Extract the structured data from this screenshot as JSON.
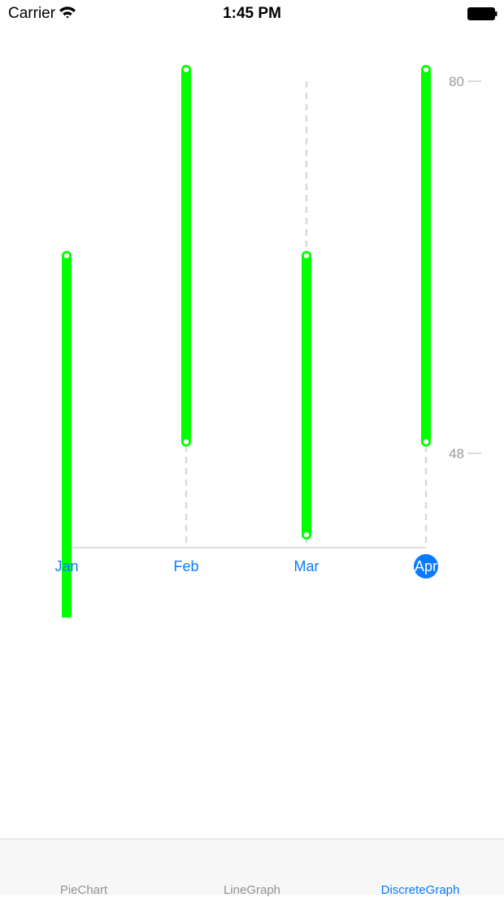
{
  "status_bar": {
    "carrier": "Carrier",
    "time": "1:45 PM",
    "icons": [
      "wifi-icon",
      "battery-icon"
    ]
  },
  "chart_data": {
    "type": "bar",
    "subtype": "floating-range",
    "categories": [
      "Jan",
      "Feb",
      "Mar",
      "Apr"
    ],
    "series": [
      {
        "ranges": [
          [
            33,
            65
          ],
          [
            49,
            81
          ],
          [
            41,
            65
          ],
          [
            49,
            81
          ]
        ]
      }
    ],
    "y_ticks": [
      48,
      80
    ],
    "y_tick_labels": [
      "48",
      "80"
    ],
    "selected_category": "Apr",
    "grid": "vertical dashed",
    "axis_side": "right",
    "colors": {
      "bar": "#00ff00",
      "label": "#0a7aff",
      "selected_bg": "#0a7aff",
      "selected_text": "#ffffff",
      "tick_label": "#9b9b9b",
      "grid": "#d9d9d9"
    }
  },
  "tab_bar": {
    "items": [
      {
        "label": "PieChart",
        "selected": false
      },
      {
        "label": "LineGraph",
        "selected": false
      },
      {
        "label": "DiscreteGraph",
        "selected": true
      }
    ]
  }
}
